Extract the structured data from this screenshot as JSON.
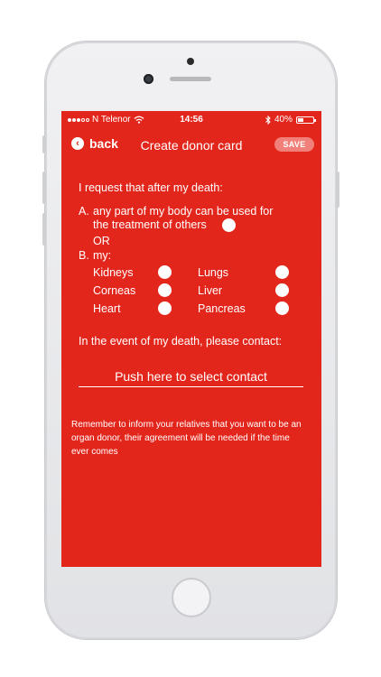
{
  "status_bar": {
    "carrier": "N Telenor",
    "time": "14:56",
    "battery": "40%",
    "battery_level": 0.4,
    "icons": [
      "signal-dots-icon",
      "wifi-icon",
      "bluetooth-icon",
      "battery-icon"
    ]
  },
  "navbar": {
    "back_label": "back",
    "title": "Create donor card",
    "save_label": "SAVE"
  },
  "form": {
    "intro": "I request that after my death:",
    "option_a_letter": "A.",
    "option_a_line1": "any part of my body can be used for",
    "option_a_line2": "the treatment of others",
    "or": "OR",
    "option_b_letter": "B.",
    "option_b_label": "my:",
    "organs_left": [
      "Kidneys",
      "Corneas",
      "Heart"
    ],
    "organs_right": [
      "Lungs",
      "Liver",
      "Pancreas"
    ]
  },
  "contact": {
    "prompt": "In the event of my death, please contact:",
    "button": "Push here to select contact"
  },
  "note": "Remember to inform your relatives that you want to be an organ donor, their agreement will be needed if the time ever comes",
  "colors": {
    "brand_red": "#e3261c",
    "save_button_bg": "#f08079",
    "text": "#ffffff"
  }
}
